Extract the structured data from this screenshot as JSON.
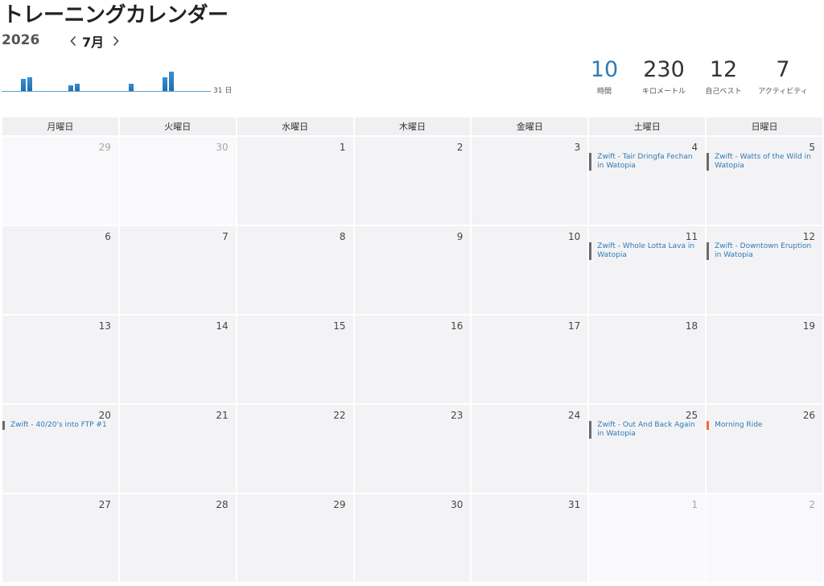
{
  "page": {
    "title": "トレーニングカレンダー"
  },
  "nav": {
    "year": "2026",
    "month": "7月",
    "prev_icon": "chevron-left-icon",
    "next_icon": "chevron-right-icon"
  },
  "mini_chart": {
    "end_label": "31 日",
    "bars": [
      0.55,
      0.62,
      0.25,
      0.33,
      0.33,
      0.6,
      0.85
    ],
    "bar_color": "#2680c2"
  },
  "stats": [
    {
      "value": "10",
      "label": "時間",
      "highlight": true
    },
    {
      "value": "230",
      "label": "キロメートル",
      "highlight": false
    },
    {
      "value": "12",
      "label": "自己ベスト",
      "highlight": false
    },
    {
      "value": "7",
      "label": "アクティビティ",
      "highlight": false
    }
  ],
  "calendar": {
    "weekdays": [
      "月曜日",
      "火曜日",
      "水曜日",
      "木曜日",
      "金曜日",
      "土曜日",
      "日曜日"
    ],
    "days": [
      {
        "num": "29",
        "other": true
      },
      {
        "num": "30",
        "other": true
      },
      {
        "num": "1"
      },
      {
        "num": "2"
      },
      {
        "num": "3"
      },
      {
        "num": "4",
        "activity": "Zwift - Tair Dringfa Fechan in Watopia"
      },
      {
        "num": "5",
        "activity": "Zwift - Watts of the Wild in Watopia"
      },
      {
        "num": "6"
      },
      {
        "num": "7"
      },
      {
        "num": "8"
      },
      {
        "num": "9"
      },
      {
        "num": "10"
      },
      {
        "num": "11",
        "activity": "Zwift - Whole Lotta Lava in Watopia"
      },
      {
        "num": "12",
        "activity": "Zwift - Downtown Eruption in Watopia"
      },
      {
        "num": "13"
      },
      {
        "num": "14"
      },
      {
        "num": "15"
      },
      {
        "num": "16"
      },
      {
        "num": "17"
      },
      {
        "num": "18"
      },
      {
        "num": "19"
      },
      {
        "num": "20",
        "activity": "Zwift - 40/20's into FTP #1"
      },
      {
        "num": "21"
      },
      {
        "num": "22"
      },
      {
        "num": "23"
      },
      {
        "num": "24"
      },
      {
        "num": "25",
        "activity": "Zwift - Out And Back Again in Watopia"
      },
      {
        "num": "26",
        "activity": "Morning Ride",
        "type": "run"
      },
      {
        "num": "27"
      },
      {
        "num": "28"
      },
      {
        "num": "29"
      },
      {
        "num": "30"
      },
      {
        "num": "31"
      },
      {
        "num": "1",
        "other": true
      },
      {
        "num": "2",
        "other": true
      }
    ]
  }
}
